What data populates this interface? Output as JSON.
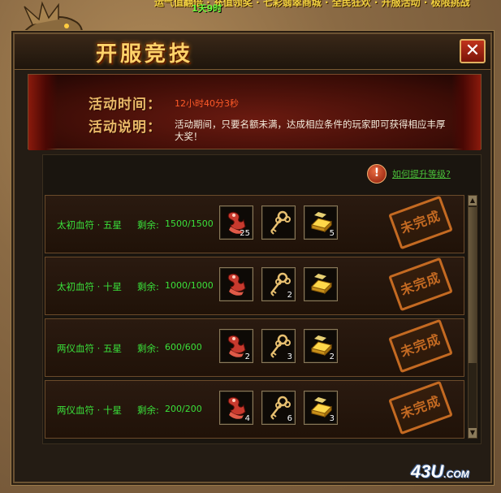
{
  "top": {
    "scroll_text": "运气值翻倍 · 充值领奖 · 七彩翡翠商城 · 全民狂欢 · 开服活动 · 极限挑战",
    "timer": "1天9时"
  },
  "window": {
    "title": "开服竞技",
    "close_label": "✕"
  },
  "banner": {
    "time_label": "活动时间：",
    "time_value": "12小时40分3秒",
    "desc_label": "活动说明：",
    "desc_value": "活动期间，只要名额未满，达成相应条件的玩家即可获得相应丰厚大奖！"
  },
  "help": {
    "icon": "!",
    "link_text": "如何提升等级?"
  },
  "rows": [
    {
      "name": "太初血符 · 五星",
      "remaining_label": "剩余:",
      "remaining": "1500/1500",
      "items": [
        "25",
        "",
        "5"
      ],
      "status": "未完成"
    },
    {
      "name": "太初血符 · 十星",
      "remaining_label": "剩余:",
      "remaining": "1000/1000",
      "items": [
        "",
        "2",
        ""
      ],
      "status": "未完成"
    },
    {
      "name": "两仪血符 · 五星",
      "remaining_label": "剩余:",
      "remaining": "600/600",
      "items": [
        "2",
        "3",
        "2"
      ],
      "status": "未完成"
    },
    {
      "name": "两仪血符 · 十星",
      "remaining_label": "剩余:",
      "remaining": "200/200",
      "items": [
        "4",
        "6",
        "3"
      ],
      "status": "未完成"
    }
  ],
  "icons": {
    "item1": "blood-talisman-icon",
    "item2": "golden-key-icon",
    "item3": "gold-ingot-icon"
  },
  "watermark": {
    "main": "43U",
    "suffix": ".COM"
  }
}
